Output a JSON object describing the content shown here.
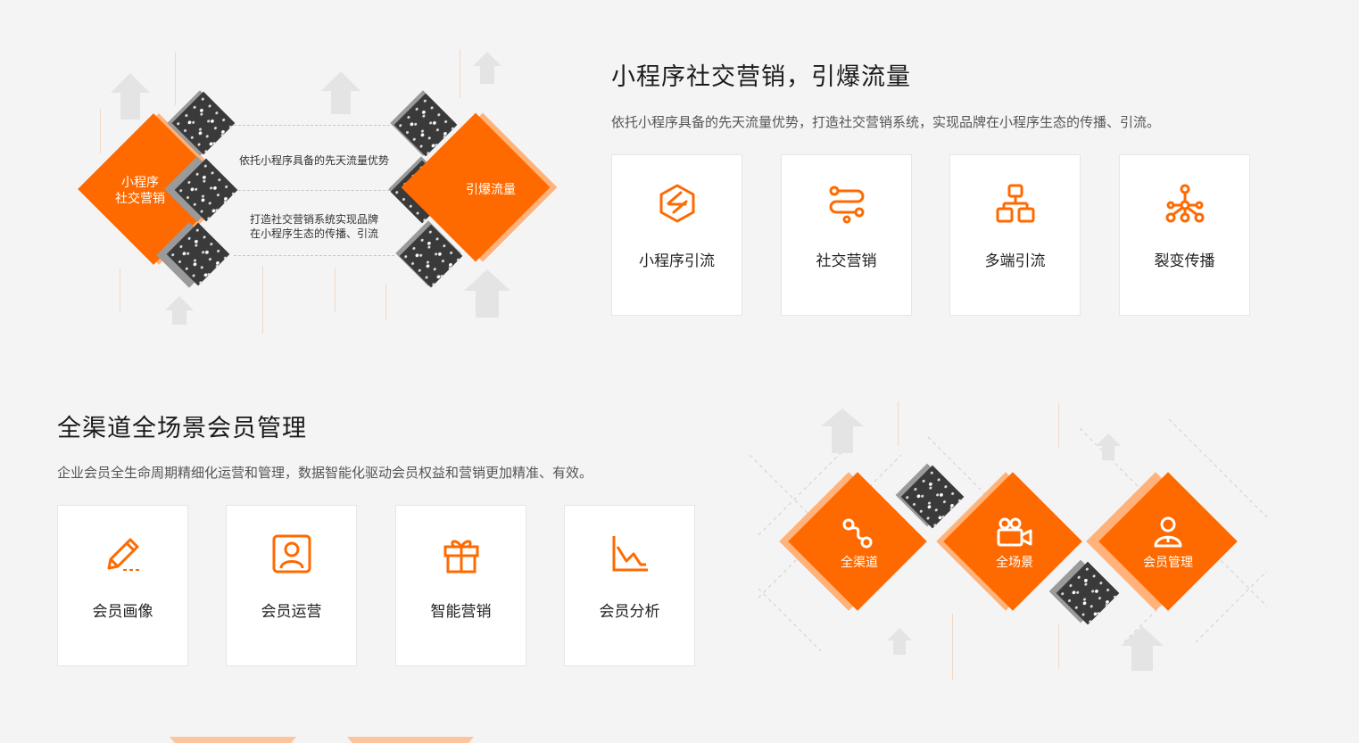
{
  "section1": {
    "title": "小程序社交营销，引爆流量",
    "desc": "依托小程序具备的先天流量优势，打造社交营销系统，实现品牌在小程序生态的传播、引流。",
    "diagram": {
      "left_label": "小程序\n社交营销",
      "right_label": "引爆流量",
      "text_top": "依托小程序具备的先天流量优势",
      "text_bottom": "打造社交营销系统实现品牌\n在小程序生态的传播、引流"
    },
    "cards": [
      {
        "label": "小程序引流",
        "icon": "hexagon-icon"
      },
      {
        "label": "社交营销",
        "icon": "flow-icon"
      },
      {
        "label": "多端引流",
        "icon": "hierarchy-icon"
      },
      {
        "label": "裂变传播",
        "icon": "network-icon"
      }
    ]
  },
  "section2": {
    "title": "全渠道全场景会员管理",
    "desc": "企业会员全生命周期精细化运营和管理，数据智能化驱动会员权益和营销更加精准、有效。",
    "cards": [
      {
        "label": "会员画像",
        "icon": "pencil-icon"
      },
      {
        "label": "会员运营",
        "icon": "user-card-icon"
      },
      {
        "label": "智能营销",
        "icon": "gift-icon"
      },
      {
        "label": "会员分析",
        "icon": "chart-icon"
      }
    ],
    "diagram": {
      "items": [
        "全渠道",
        "全场景",
        "会员管理"
      ]
    }
  },
  "colors": {
    "accent": "#ff6a00",
    "accent_light": "#ffb27a",
    "dark": "#3a3a3a"
  }
}
